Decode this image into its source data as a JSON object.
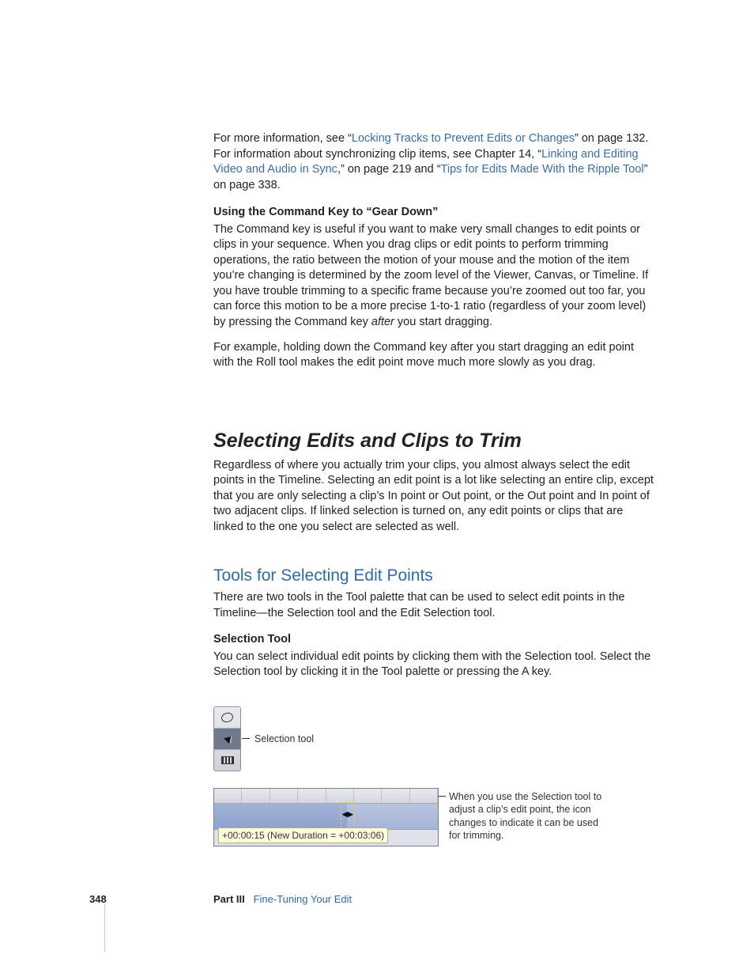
{
  "page_number": "348",
  "footer": {
    "part": "Part III",
    "title": "Fine-Tuning Your Edit"
  },
  "intro": {
    "pre_link1": "For more information, see “",
    "link1": "Locking Tracks to Prevent Edits or Changes",
    "after_link1": "” on page 132. For information about synchronizing clip items, see Chapter 14, “",
    "link2": "Linking and Editing Video and Audio in Sync",
    "after_link2": ",” on page 219 and “",
    "link3": "Tips for Edits Made With the Ripple Tool",
    "after_link3": "” on page 338."
  },
  "gear": {
    "heading": "Using the Command Key to “Gear Down”",
    "p1a": "The Command key is useful if you want to make very small changes to edit points or clips in your sequence. When you drag clips or edit points to perform trimming operations, the ratio between the motion of your mouse and the motion of the item you’re changing is determined by the zoom level of the Viewer, Canvas, or Timeline. If you have trouble trimming to a specific frame because you’re zoomed out too far, you can force this motion to be a more precise 1-to-1 ratio (regardless of your zoom level) by pressing the Command key ",
    "p1_italic": "after",
    "p1b": " you start dragging.",
    "p2": "For example, holding down the Command key after you start dragging an edit point with the Roll tool makes the edit point move much more slowly as you drag."
  },
  "h2": "Selecting Edits and Clips to Trim",
  "h2_body": "Regardless of where you actually trim your clips, you almost always select the edit points in the Timeline. Selecting an edit point is a lot like selecting an entire clip, except that you are only selecting a clip’s In point or Out point, or the Out point and In point of two adjacent clips. If linked selection is turned on, any edit points or clips that are linked to the one you select are selected as well.",
  "h3": "Tools for Selecting Edit Points",
  "h3_body": "There are two tools in the Tool palette that can be used to select edit points in the Timeline—the Selection tool and the Edit Selection tool.",
  "sel_tool": {
    "heading": "Selection Tool",
    "body": "You can select individual edit points by clicking them with the Selection tool. Select the Selection tool by clicking it in the Tool palette or pressing the A key."
  },
  "fig1_caption": "Selection tool",
  "fig2_caption": "When you use the Selection tool to adjust a clip’s edit point, the icon changes to indicate it can be used for trimming.",
  "fig2_tooltip": "+00:00:15 (New Duration = +00:03:06)"
}
